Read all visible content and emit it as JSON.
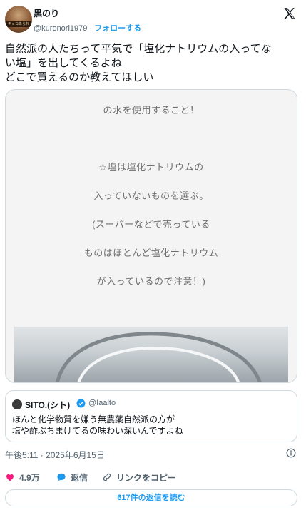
{
  "author": {
    "name": "黒のり",
    "handle": "@kuronori1979",
    "separator": " · ",
    "follow_label": "フォローする",
    "avatar_caption": "チョコあられ"
  },
  "tweet": {
    "line1": "自然派の人たちって平気で「塩化ナトリウムの入ってな",
    "line2": "い塩」を出してくるよね",
    "line3": "どこで買えるのか教えてほしい"
  },
  "media": {
    "lines": [
      "の水を使用すること！",
      "☆塩は塩化ナトリウムの",
      "入っていないものを選ぶ。",
      "(スーパーなどで売っている",
      "ものはほとんど塩化ナトリウム",
      "が入っているので注意！)"
    ]
  },
  "quote": {
    "name": "SITO.(シト)",
    "handle": "@Iaalto",
    "line1": "ほんと化学物質を嫌う無農薬自然派の方が",
    "line2": "塩や酢ぶちまけてるの味わい深いんですよね"
  },
  "timestamp": "午後5:11 · 2025年6月15日",
  "actions": {
    "likes": "4.9万",
    "reply_label": "返信",
    "copy_link_label": "リンクをコピー"
  },
  "read_replies_label": "617件の返信を読む",
  "colors": {
    "accent": "#1d9bf0",
    "like": "#f91880",
    "text": "#0f1419",
    "muted": "#536471",
    "border": "#cfd9de"
  },
  "icons": [
    "x-logo-icon",
    "verified-badge-icon",
    "info-icon",
    "heart-icon",
    "reply-icon",
    "link-icon"
  ]
}
